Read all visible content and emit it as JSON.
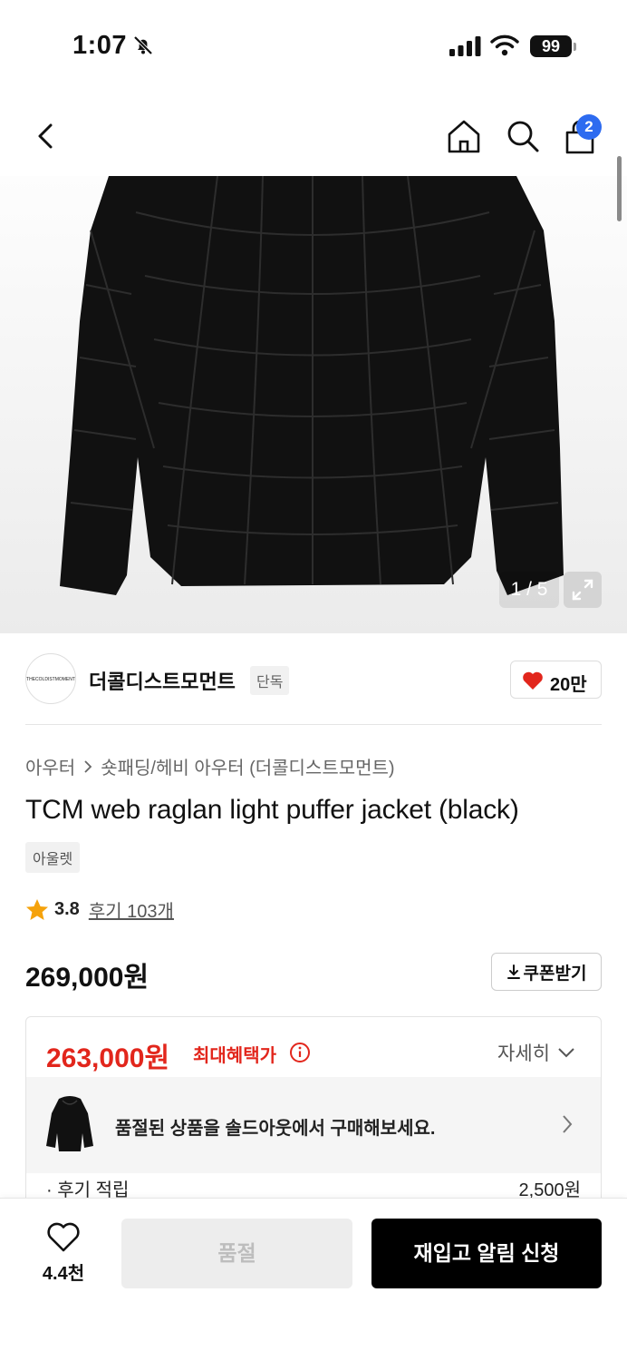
{
  "status_bar": {
    "time": "1:07",
    "battery": "99"
  },
  "nav": {
    "cart_count": "2"
  },
  "gallery": {
    "counter": "1 / 5"
  },
  "brand": {
    "logo_text": "THECOLDISTMOMENT",
    "name": "더콜디스트모먼트",
    "tag": "단독",
    "like_count": "20만"
  },
  "breadcrumb": {
    "category": "아우터",
    "subcategory": "숏패딩/헤비 아우터 (더콜디스트모먼트)"
  },
  "product": {
    "title": "TCM web raglan light puffer jacket (black)",
    "outlet_tag": "아울렛",
    "rating": "3.8",
    "review_link": "후기 103개",
    "price": "269,000원"
  },
  "coupon": {
    "label": "쿠폰받기"
  },
  "benefit": {
    "price": "263,000원",
    "label": "최대혜택가",
    "detail_toggle": "자세히",
    "soldout_banner": "품절된 상품을 솔드아웃에서 구매해보세요.",
    "review_point_label": "· 후기 적립",
    "review_point_value": "2,500원"
  },
  "bottom_bar": {
    "wish_count": "4.4천",
    "soldout_label": "품절",
    "restock_label": "재입고 알림 신청"
  },
  "colors": {
    "accent_red": "#e2261c",
    "badge_blue": "#2d6bf0",
    "primary_black": "#000000"
  }
}
